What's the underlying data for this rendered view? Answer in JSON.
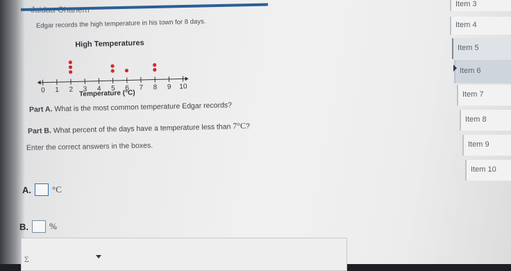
{
  "header": {
    "student_name": "Jaidaa Ghanem"
  },
  "question": {
    "prompt": "Edgar records the high temperature in his town for 8 days.",
    "part_a": {
      "label": "Part A.",
      "text": "What is the most common temperature Edgar records?"
    },
    "part_b": {
      "label": "Part B.",
      "text_before": "What percent of the days have a temperature less than ",
      "value": "7",
      "unit": "°C",
      "text_after": "?"
    },
    "instructions": "Enter the correct answers in the boxes."
  },
  "answers": [
    {
      "letter": "A.",
      "value": "",
      "unit": "°C"
    },
    {
      "letter": "B.",
      "value": "",
      "unit": "%"
    }
  ],
  "math_toolbar": {
    "symbol": "Σ"
  },
  "chart_data": {
    "type": "scatter",
    "subtype": "dot-plot",
    "title": "High Temperatures",
    "xlabel": "Temperature (°C)",
    "ticks": [
      0,
      1,
      2,
      3,
      4,
      5,
      6,
      7,
      8,
      9,
      10
    ],
    "xlim": [
      0,
      10
    ],
    "dot_color": "#d6282f",
    "points": [
      {
        "x": 2,
        "count": 3
      },
      {
        "x": 5,
        "count": 2
      },
      {
        "x": 6,
        "count": 1
      },
      {
        "x": 8,
        "count": 2
      }
    ]
  },
  "nav": {
    "items": [
      {
        "label": "Item 3"
      },
      {
        "label": "Item 4"
      },
      {
        "label": "Item 5"
      },
      {
        "label": "Item 6"
      },
      {
        "label": "Item 7"
      },
      {
        "label": "Item 8"
      },
      {
        "label": "Item 9"
      },
      {
        "label": "Item 10"
      }
    ]
  }
}
